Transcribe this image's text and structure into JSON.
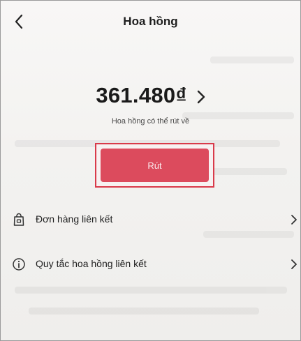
{
  "header": {
    "title": "Hoa hồng",
    "back_icon": "chevron-left-icon"
  },
  "commission": {
    "amount": "361.480₫",
    "caption": "Hoa hồng có thể rút về",
    "chevron_icon": "chevron-right-icon"
  },
  "withdraw": {
    "label": "Rút",
    "color": "#dc4b5d",
    "highlight_border": "#d93a4a"
  },
  "menu": {
    "items": [
      {
        "icon": "shopping-bag-icon",
        "label": "Đơn hàng liên kết"
      },
      {
        "icon": "info-icon",
        "label": "Quy tắc hoa hồng liên kết"
      }
    ]
  }
}
